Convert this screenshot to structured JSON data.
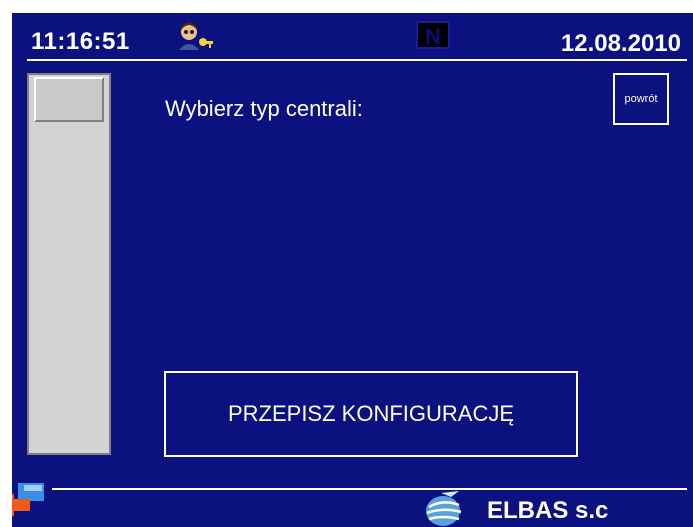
{
  "header": {
    "time": "11:16:51",
    "date": "12.08.2010",
    "mode_badge": "N",
    "user_icon": "user-with-key-icon"
  },
  "main": {
    "prompt": "Wybierz typ centrali:",
    "back_label": "powrót",
    "rewrite_label": "PRZEPISZ KONFIGURACJĘ"
  },
  "footer": {
    "brand": "ELBAS s.c",
    "logo_icon": "globe-logo-icon",
    "nav_icon": "back-arrow-icon"
  },
  "colors": {
    "background": "#0c1180",
    "text": "#ffffff",
    "scrollbar": "#d3d3d3"
  }
}
